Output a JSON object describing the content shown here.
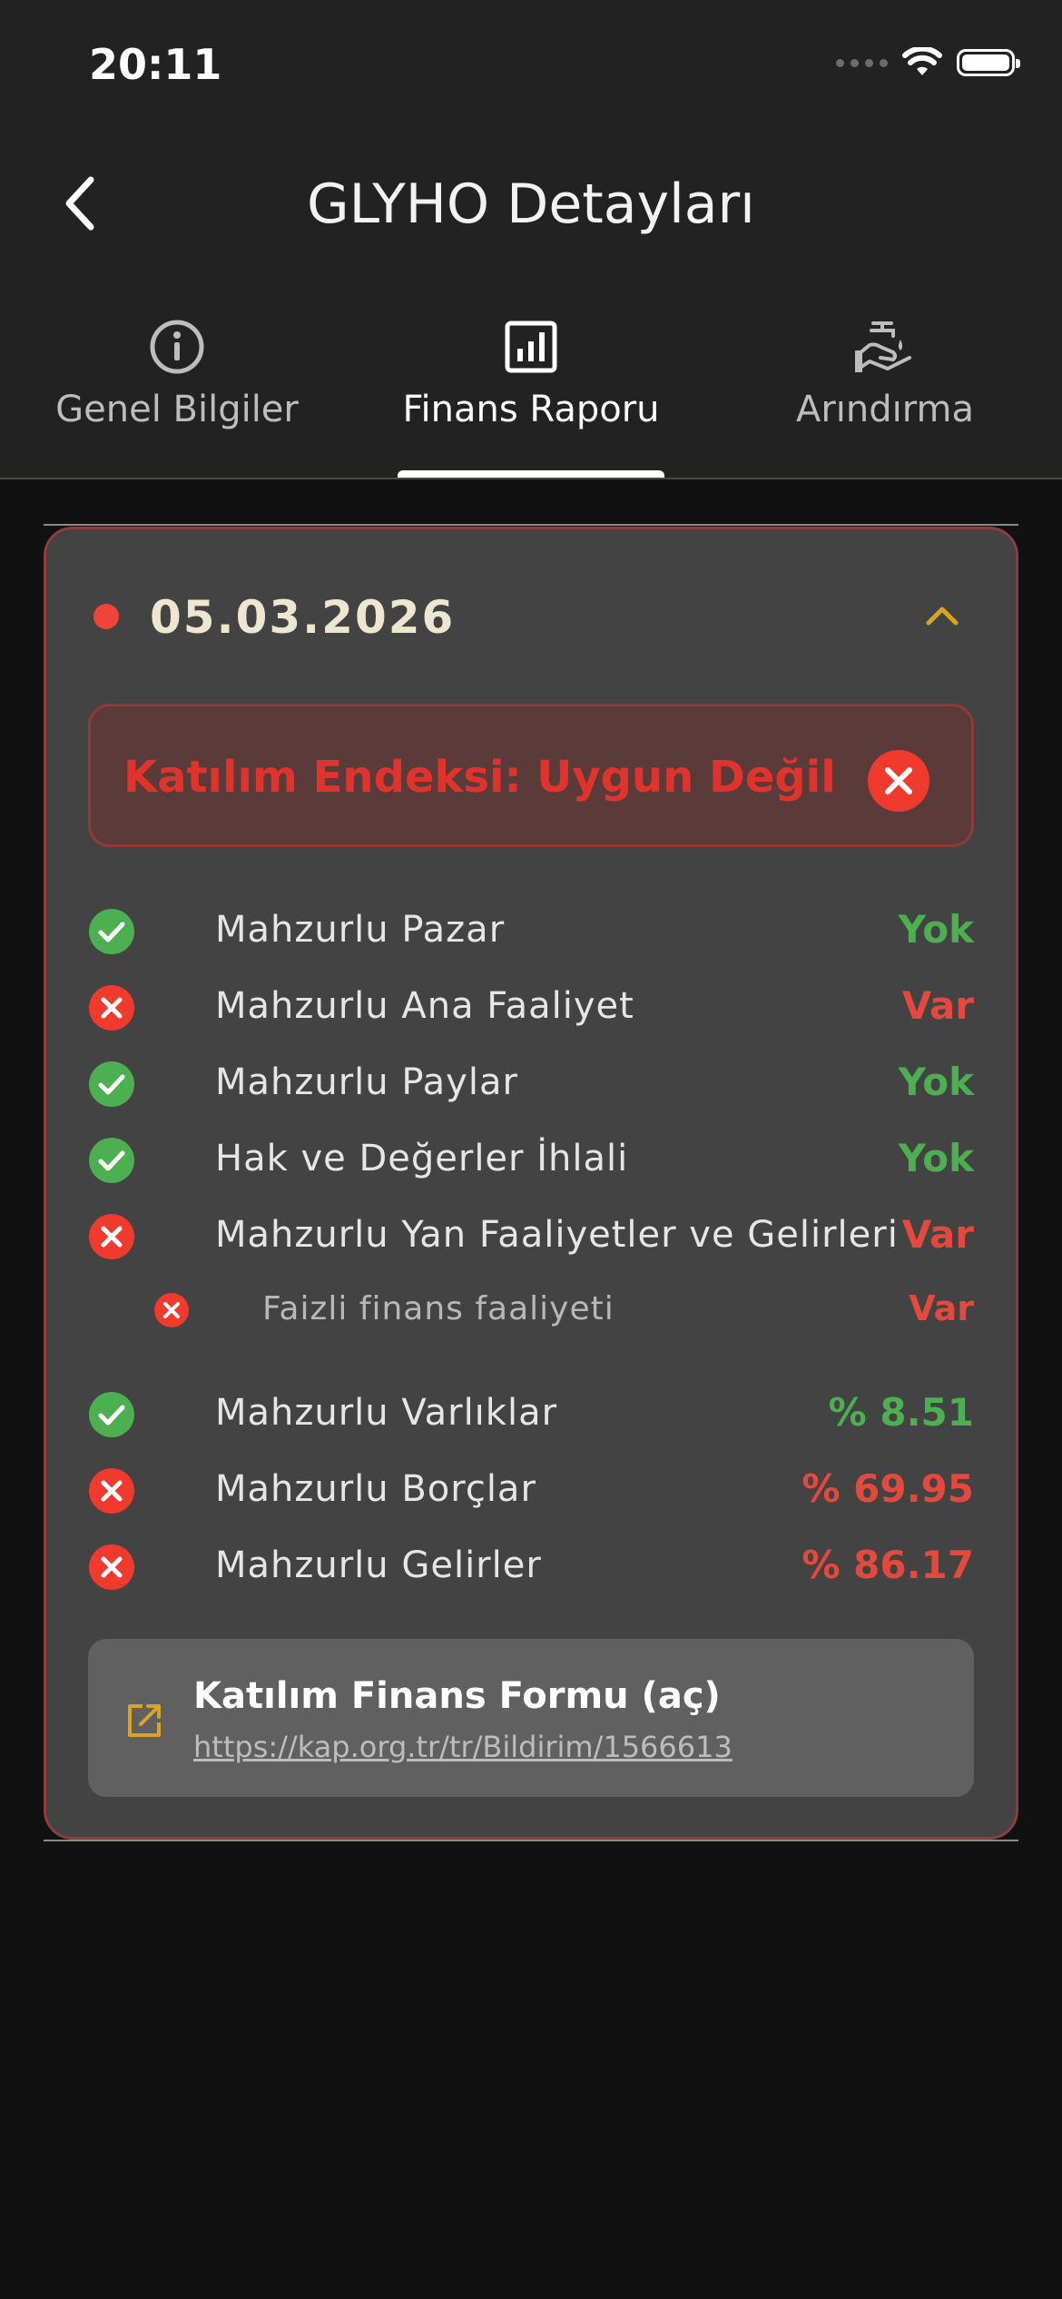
{
  "status_bar": {
    "time": "20:11"
  },
  "header": {
    "title": "GLYHO Detayları"
  },
  "tabs": [
    {
      "label": "Genel Bilgiler",
      "icon": "info-icon",
      "active": false
    },
    {
      "label": "Finans Raporu",
      "icon": "bar-chart-icon",
      "active": true
    },
    {
      "label": "Arındırma",
      "icon": "hand-wash-icon",
      "active": false
    }
  ],
  "report": {
    "date": "05.03.2026",
    "expanded": true,
    "banner": {
      "text": "Katılım Endeksi: Uygun Değil",
      "status": "fail"
    },
    "items": [
      {
        "label": "Mahzurlu Pazar",
        "value": "Yok",
        "status": "ok"
      },
      {
        "label": "Mahzurlu Ana Faaliyet",
        "value": "Var",
        "status": "fail"
      },
      {
        "label": "Mahzurlu Paylar",
        "value": "Yok",
        "status": "ok"
      },
      {
        "label": "Hak ve Değerler İhlali",
        "value": "Yok",
        "status": "ok"
      },
      {
        "label": "Mahzurlu Yan Faaliyetler ve Gelirleri",
        "value": "Var",
        "status": "fail"
      },
      {
        "label": "Faizli finans faaliyeti",
        "value": "Var",
        "status": "fail",
        "sub": true
      }
    ],
    "ratios": [
      {
        "label": "Mahzurlu Varlıklar",
        "value": "% 8.51",
        "status": "ok"
      },
      {
        "label": "Mahzurlu Borçlar",
        "value": "% 69.95",
        "status": "fail"
      },
      {
        "label": "Mahzurlu Gelirler",
        "value": "% 86.17",
        "status": "fail"
      }
    ],
    "link": {
      "title": "Katılım Finans Formu (aç)",
      "url": "https://kap.org.tr/tr/Bildirim/1566613",
      "icon": "external-link-icon"
    }
  },
  "colors": {
    "ok": "#4caf50",
    "fail": "#e5483c",
    "accent": "#d9a520",
    "card_bg": "#434343",
    "banner_bg": "#5b3b39"
  }
}
